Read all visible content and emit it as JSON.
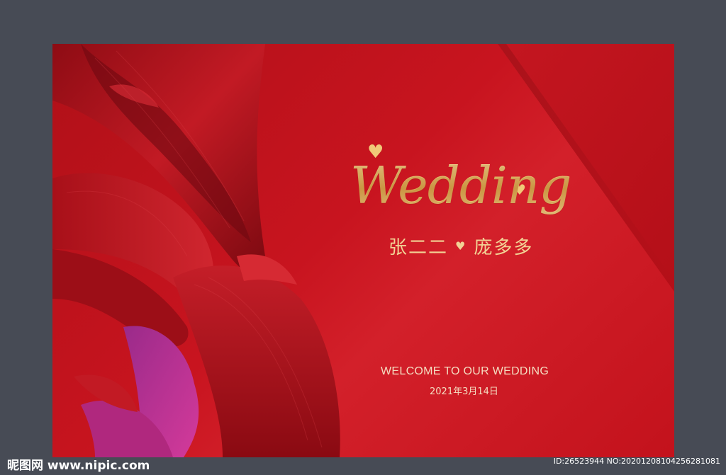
{
  "card": {
    "title": "Wedding",
    "names": {
      "groom": "张二二",
      "bride": "庞多多"
    },
    "welcome": "WELCOME TO OUR WEDDING",
    "date": "2021年3月14日",
    "colors": {
      "background": "#c8141f",
      "gold": "#e8c47a",
      "frame": "#474b55"
    }
  },
  "watermark": {
    "site": "昵图网 www.nipic.com",
    "id_text": "ID:26523944 NO:20201208104256281081"
  }
}
